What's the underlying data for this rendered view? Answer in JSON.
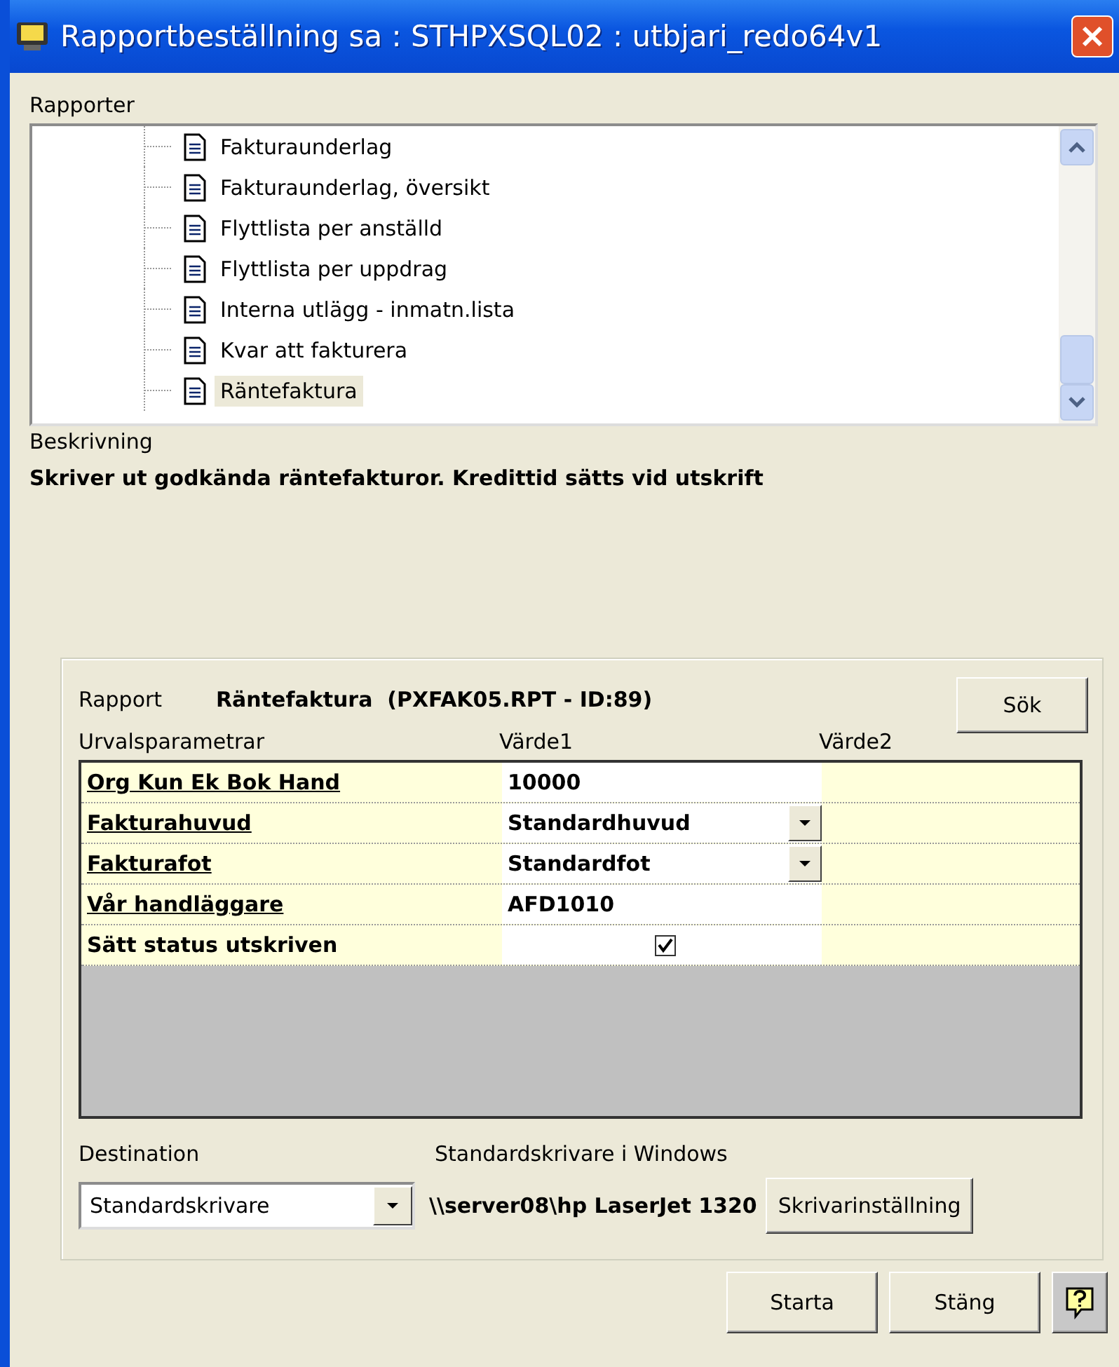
{
  "window": {
    "title": "Rapportbeställning sa : STHPXSQL02 : utbjari_redo64v1"
  },
  "reports": {
    "label": "Rapporter",
    "items": [
      {
        "label": "Fakturaunderlag",
        "selected": false
      },
      {
        "label": "Fakturaunderlag, översikt",
        "selected": false
      },
      {
        "label": "Flyttlista per anställd",
        "selected": false
      },
      {
        "label": "Flyttlista per uppdrag",
        "selected": false
      },
      {
        "label": "Interna utlägg - inmatn.lista",
        "selected": false
      },
      {
        "label": "Kvar att fakturera",
        "selected": false
      },
      {
        "label": "Räntefaktura",
        "selected": true
      }
    ]
  },
  "description": {
    "label": "Beskrivning",
    "text": "Skriver ut godkända räntefakturor. Kredittid sätts vid utskrift"
  },
  "report": {
    "label": "Rapport",
    "value": "Räntefaktura  (PXFAK05.RPT - ID:89)",
    "search_button": "Sök"
  },
  "parameters": {
    "columns": [
      "Urvalsparametrar",
      "Värde1",
      "Värde2"
    ],
    "rows": [
      {
        "name": "Org Kun Ek Bok Hand",
        "linked": true,
        "kind": "text",
        "value": "10000"
      },
      {
        "name": "Fakturahuvud",
        "linked": true,
        "kind": "dropdown",
        "value": "Standardhuvud"
      },
      {
        "name": "Fakturafot",
        "linked": true,
        "kind": "dropdown",
        "value": "Standardfot"
      },
      {
        "name": "Vår handläggare",
        "linked": true,
        "kind": "text",
        "value": "AFD1010"
      },
      {
        "name": "Sätt status utskriven",
        "linked": false,
        "kind": "checkbox",
        "checked": true
      }
    ]
  },
  "destination": {
    "label": "Destination",
    "value": "Standardskrivare",
    "printer_label": "Standardskrivare i Windows",
    "printer": "\\\\server08\\hp LaserJet 1320",
    "settings_button": "Skrivarinställning"
  },
  "buttons": [
    "Starta",
    "Stäng"
  ]
}
